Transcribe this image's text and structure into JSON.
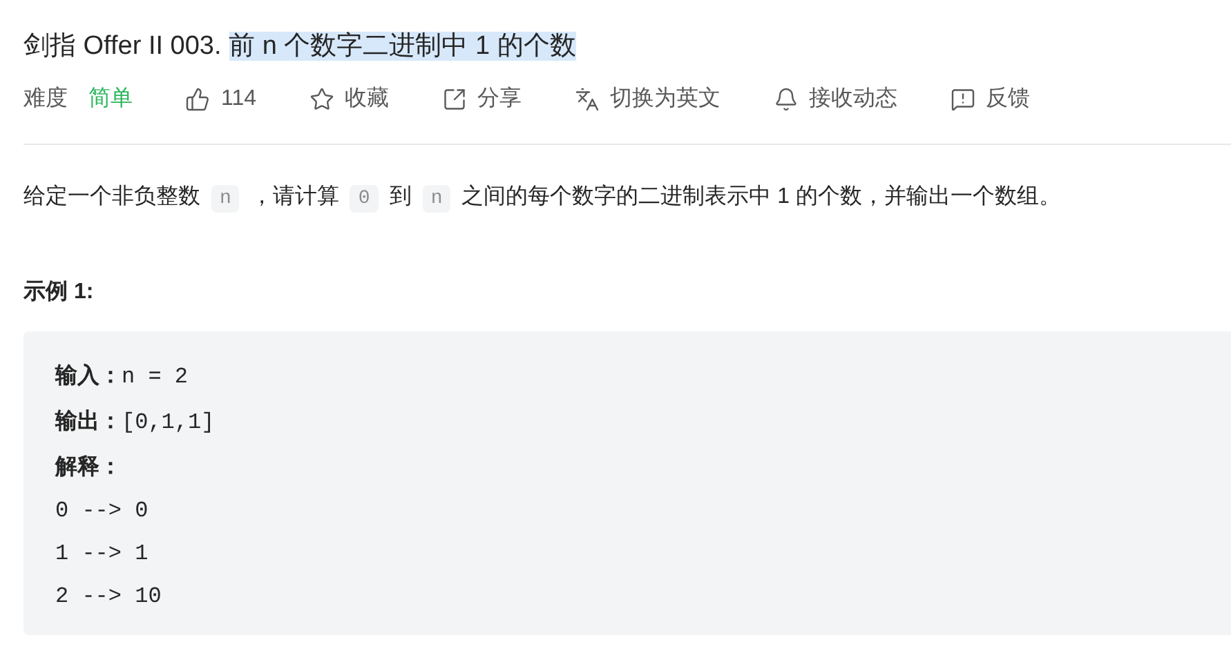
{
  "title": {
    "prefix": "剑指 Offer II 003.",
    "text": "前 n 个数字二进制中 1 的个数",
    "highlighted": true
  },
  "meta": {
    "label": "难度",
    "difficulty": "简单"
  },
  "actions": [
    {
      "kind": "like",
      "label": "114"
    },
    {
      "kind": "star",
      "label": "收藏"
    },
    {
      "kind": "share",
      "label": "分享"
    },
    {
      "kind": "translate",
      "label": "切换为英文"
    },
    {
      "kind": "bell",
      "label": "接收动态"
    },
    {
      "kind": "feedback",
      "label": "反馈"
    }
  ],
  "description": [
    {
      "kind": "text",
      "text": "给定一个非负整数"
    },
    {
      "kind": "code",
      "text": "n"
    },
    {
      "kind": "text",
      "text": "，请计算"
    },
    {
      "kind": "code",
      "text": "0"
    },
    {
      "kind": "text",
      "text": "到"
    },
    {
      "kind": "code",
      "text": "n"
    },
    {
      "kind": "text",
      "text": "之间的每个数字的二进制表示中 1 的个数，并输出一个数组。"
    }
  ],
  "example": {
    "heading": "示例 1:",
    "lines": [
      {
        "label": "输入：",
        "value": "n = 2"
      },
      {
        "label": "输出：",
        "value": "[0,1,1]"
      },
      {
        "label": "解释："
      },
      {
        "value": "0 --> 0"
      },
      {
        "value": "1 --> 1"
      },
      {
        "value": "2 --> 10"
      }
    ]
  }
}
